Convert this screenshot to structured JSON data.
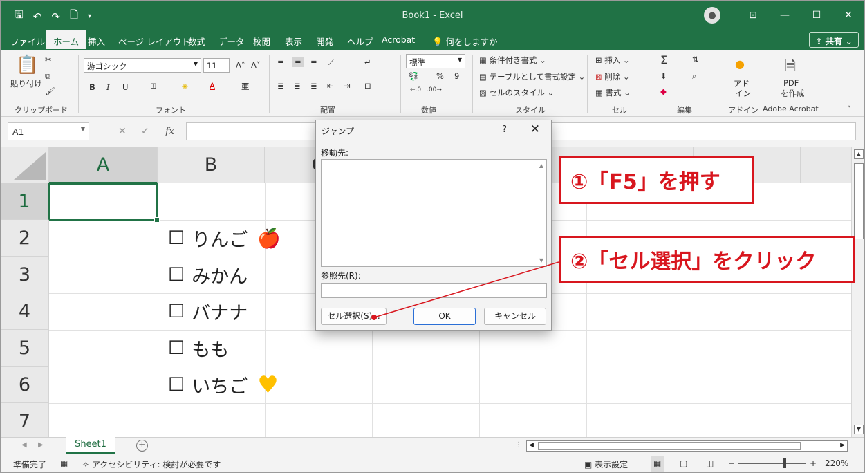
{
  "titlebar": {
    "title": "Book1  -  Excel",
    "qat": {
      "save": "🖫",
      "undo": "↶",
      "redo": "↷",
      "new": "🗋",
      "more": "▾"
    },
    "avatar": "●",
    "ribbon_display": "⊡",
    "minimize": "—",
    "maximize": "☐",
    "close": "✕"
  },
  "tabs": [
    "ファイル",
    "ホーム",
    "挿入",
    "ページ レイアウト",
    "数式",
    "データ",
    "校閲",
    "表示",
    "開発",
    "ヘルプ",
    "Acrobat",
    "何をしますか"
  ],
  "share_label": "共有",
  "ribbon": {
    "clipboard": {
      "paste_label": "貼り付け",
      "group": "クリップボード"
    },
    "font": {
      "name": "游ゴシック",
      "size": "11",
      "grow": "A˄",
      "shrink": "A˅",
      "bold": "B",
      "italic": "I",
      "underline": "U",
      "group": "フォント"
    },
    "alignment": {
      "group": "配置"
    },
    "number": {
      "format": "標準",
      "percent": "%",
      "comma": "9",
      "group": "数値"
    },
    "styles": {
      "conditional": "条件付き書式",
      "table": "テーブルとして書式設定",
      "cell": "セルのスタイル",
      "group": "スタイル"
    },
    "cells": {
      "insert": "挿入",
      "delete": "削除",
      "format": "書式",
      "group": "セル"
    },
    "editing": {
      "sum": "Σ",
      "group": "編集"
    },
    "addins": {
      "label1": "アド",
      "label2": "イン",
      "group": "アドイン"
    },
    "acrobat": {
      "label1": "PDF",
      "label2": "を作成",
      "group": "Adobe Acrobat"
    }
  },
  "formula_bar": {
    "name_box": "A1",
    "cancel": "✕",
    "enter": "✓",
    "fx": "fx"
  },
  "grid": {
    "columns": [
      "A",
      "B",
      "C"
    ],
    "rows": [
      "1",
      "2",
      "3",
      "4",
      "5",
      "6",
      "7"
    ],
    "items": [
      {
        "checkbox": "☐",
        "label": "りんご",
        "emoji": "🍎",
        "emoji_color": "#f28c28"
      },
      {
        "checkbox": "☐",
        "label": "みかん",
        "emoji": ""
      },
      {
        "checkbox": "☐",
        "label": "バナナ",
        "emoji": ""
      },
      {
        "checkbox": "☐",
        "label": "もも",
        "emoji": ""
      },
      {
        "checkbox": "☐",
        "label": "いちご",
        "emoji": "♥",
        "emoji_color": "#ffc000"
      }
    ]
  },
  "sheets": {
    "tab": "Sheet1",
    "add": "+"
  },
  "status": {
    "ready": "準備完了",
    "accessibility": "アクセシビリティ: 検討が必要です",
    "display_settings": "表示設定",
    "zoom": "220%",
    "zoom_minus": "−",
    "zoom_plus": "+"
  },
  "dialog": {
    "title": "ジャンプ",
    "help": "?",
    "close": "✕",
    "goto_label": "移動先:",
    "reference_label": "参照先(R):",
    "special_button": "セル選択(S)...",
    "ok_button": "OK",
    "cancel_button": "キャンセル"
  },
  "callouts": {
    "step1": "①「F5」を押す",
    "step2": "②「セル選択」をクリック",
    "color": "#d8161e"
  }
}
